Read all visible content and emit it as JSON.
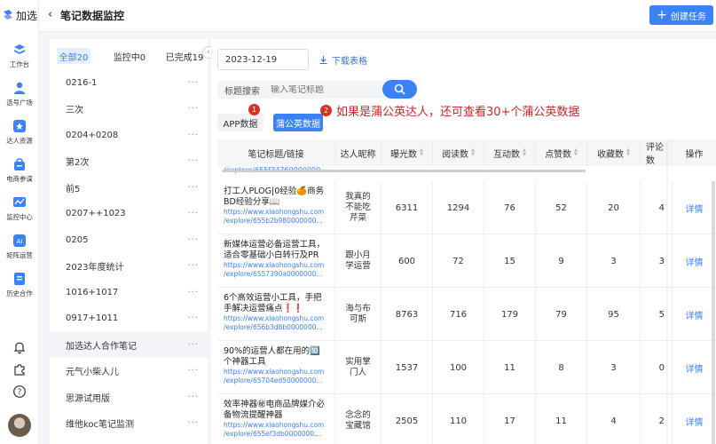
{
  "app": {
    "name": "加选"
  },
  "nav": [
    {
      "id": "workbench",
      "label": "工作台"
    },
    {
      "id": "selection",
      "label": "选号广场"
    },
    {
      "id": "talent",
      "label": "达人资源"
    },
    {
      "id": "ecommerce",
      "label": "电商参谋"
    },
    {
      "id": "monitor",
      "label": "监控中心"
    },
    {
      "id": "matrix",
      "label": "矩阵运营"
    },
    {
      "id": "history",
      "label": "历史合作"
    }
  ],
  "header": {
    "back": "‹",
    "title": "笔记数据监控",
    "create_label": "创建任务"
  },
  "tabs": [
    {
      "label": "全部20"
    },
    {
      "label": "监控中0"
    },
    {
      "label": "已完成19"
    }
  ],
  "list": [
    "0216-1",
    "三次",
    "0204+0208",
    "第2次",
    "前5",
    "0207++1023",
    "0205",
    "2023年度统计",
    "1016+1017",
    "0917+1011",
    "加选达人合作笔记",
    "元气小柴人儿",
    "思源试用版",
    "维他koc笔记监测"
  ],
  "list_more": "···",
  "filters": {
    "date": "2023-12-19",
    "download_label": "下载表格",
    "search_type": "标题搜索",
    "search_placeholder": "输入笔记标题",
    "app_data_label": "APP数据",
    "pgy_data_label": "蒲公英数据",
    "badge1": "1",
    "badge2": "2",
    "annotation": "如果是蒲公英达人，还可查看30+个蒲公英数据"
  },
  "columns": [
    "笔记标题/链接",
    "达人昵称",
    "曝光数",
    "阅读数",
    "互动数",
    "点赞数",
    "收藏数",
    "评论数",
    "操作"
  ],
  "scrolled_link": "/explore/655f34760000000...",
  "rows": [
    {
      "title": "打工人PLOG|0经验🍊商务BD经验分享📖",
      "link1": "https://www.xiaohongshu.com",
      "link2": "/explore/655b2b980000000...",
      "nick": "我真的不能吃芹菜",
      "exposure": "6311",
      "reads": "1294",
      "interactions": "76",
      "likes": "52",
      "favorites": "20",
      "comments": "4",
      "action": "详情"
    },
    {
      "title": "新媒体运营必备运营工具，适合零基础小白转行及PR",
      "link1": "https://www.xiaohongshu.com",
      "link2": "/explore/6557390a0000000...",
      "nick": "跟小月学运营",
      "exposure": "600",
      "reads": "72",
      "interactions": "15",
      "likes": "9",
      "favorites": "3",
      "comments": "3",
      "action": "详情"
    },
    {
      "title": "6个高效运营小工具，手把手解决运营痛点❗❗",
      "link1": "https://www.xiaohongshu.com",
      "link2": "/explore/656b3d8b0000000...",
      "nick": "海与布可斯",
      "exposure": "8763",
      "reads": "716",
      "interactions": "179",
      "likes": "79",
      "favorites": "95",
      "comments": "5",
      "action": "详情"
    },
    {
      "title": "90%的运营人都在用的🔟个神器工具",
      "link1": "https://www.xiaohongshu.com",
      "link2": "/explore/65704ed50000000...",
      "nick": "实用掌门人",
      "exposure": "1537",
      "reads": "100",
      "interactions": "11",
      "likes": "8",
      "favorites": "3",
      "comments": "0",
      "action": "详情"
    },
    {
      "title": "效率神器㊙电商品牌媒介必备物流提醒神器",
      "link1": "https://www.xiaohongshu.com",
      "link2": "/explore/655ef3db0000000...",
      "nick": "念念的宝藏馆",
      "exposure": "2505",
      "reads": "110",
      "interactions": "17",
      "likes": "11",
      "favorites": "4",
      "comments": "2",
      "action": "详情"
    }
  ]
}
